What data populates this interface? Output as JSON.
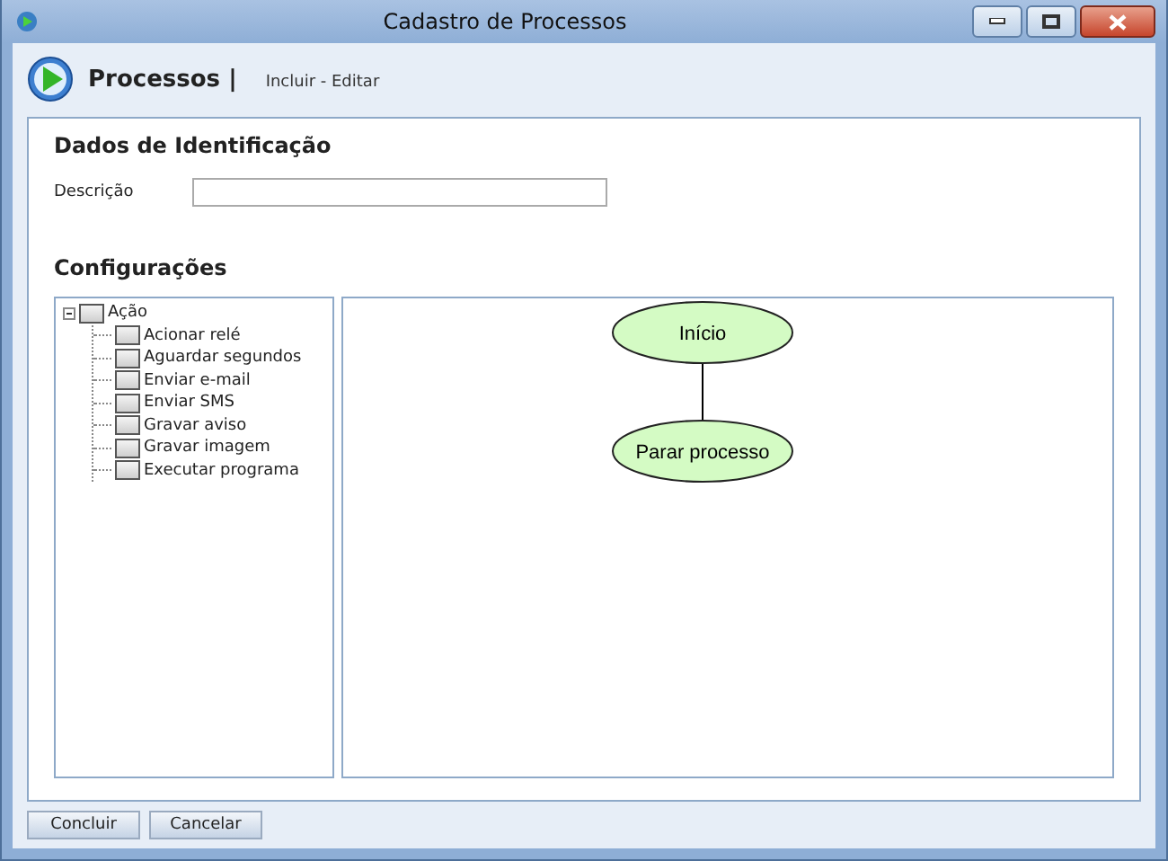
{
  "window": {
    "title": "Cadastro de Processos"
  },
  "header": {
    "title": "Processos |",
    "subtitle": "Incluir - Editar"
  },
  "identification": {
    "heading": "Dados de Identificação",
    "fields": [
      {
        "label": "Descrição"
      }
    ]
  },
  "configuration": {
    "heading": "Configurações",
    "tree": [
      {
        "label": "Ação",
        "expanded": true,
        "checked": false,
        "children": [
          {
            "label": "Acionar relé",
            "checked": false
          },
          {
            "label": "Aguardar segundos",
            "checked": false
          },
          {
            "label": "Enviar e-mail",
            "checked": false
          },
          {
            "label": "Enviar SMS",
            "checked": false
          },
          {
            "label": "Gravar aviso",
            "checked": false
          },
          {
            "label": "Gravar imagem",
            "checked": false
          },
          {
            "label": "Executar programa",
            "checked": false
          }
        ]
      }
    ],
    "diagram": {
      "nodes": [
        {
          "label": "Início"
        },
        {
          "label": "Parar processo"
        }
      ]
    }
  },
  "buttons": [
    "Concluir",
    "Cancelar"
  ]
}
